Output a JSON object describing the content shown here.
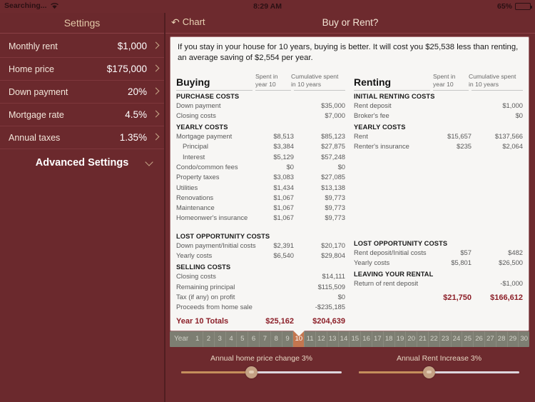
{
  "statusbar": {
    "carrier": "Searching...",
    "wifi_icon": "wifi-icon",
    "time": "8:29 AM",
    "battery_percent": "65%",
    "battery_icon": "battery-icon"
  },
  "sidebar": {
    "header": "Settings",
    "items": [
      {
        "label": "Monthly rent",
        "value": "$1,000"
      },
      {
        "label": "Home price",
        "value": "$175,000"
      },
      {
        "label": "Down payment",
        "value": "20%"
      },
      {
        "label": "Mortgage rate",
        "value": "4.5%"
      },
      {
        "label": "Annual taxes",
        "value": "1.35%"
      }
    ],
    "advanced_label": "Advanced Settings",
    "advanced_icon": "chevron-down-icon",
    "row_icon": "chevron-right-icon"
  },
  "navbar": {
    "back_label": "Chart",
    "back_icon": "back-arrow-icon",
    "title": "Buy or Rent?"
  },
  "summary": {
    "text": "If you stay in your house for  10 years, buying is better. It will cost you  $25,538 less than renting, an average saving of $2,554 per year."
  },
  "table": {
    "col_header_spent": "Spent in\nyear 10",
    "col_header_spent_l1": "Spent in",
    "col_header_spent_l2": "year 10",
    "col_header_cum_l1": "Cumulative spent",
    "col_header_cum_l2": "in 10 years",
    "buying": {
      "title": "Buying",
      "sections": [
        {
          "name": "PURCHASE COSTS",
          "rows": [
            {
              "label": "Down payment",
              "spent": "",
              "cumulative": "$35,000",
              "indent": false
            },
            {
              "label": "Closing costs",
              "spent": "",
              "cumulative": "$7,000",
              "indent": false
            }
          ]
        },
        {
          "name": "YEARLY COSTS",
          "rows": [
            {
              "label": "Mortgage payment",
              "spent": "$8,513",
              "cumulative": "$85,123",
              "indent": false
            },
            {
              "label": "Principal",
              "spent": "$3,384",
              "cumulative": "$27,875",
              "indent": true
            },
            {
              "label": "Interest",
              "spent": "$5,129",
              "cumulative": "$57,248",
              "indent": true
            },
            {
              "label": "Condo/common fees",
              "spent": "$0",
              "cumulative": "$0",
              "indent": false
            },
            {
              "label": "Property taxes",
              "spent": "$3,083",
              "cumulative": "$27,085",
              "indent": false
            },
            {
              "label": "Utilities",
              "spent": "$1,434",
              "cumulative": "$13,138",
              "indent": false
            },
            {
              "label": "Renovations",
              "spent": "$1,067",
              "cumulative": "$9,773",
              "indent": false
            },
            {
              "label": "Maintenance",
              "spent": "$1,067",
              "cumulative": "$9,773",
              "indent": false
            },
            {
              "label": "Homeonwer's insurance",
              "spent": "$1,067",
              "cumulative": "$9,773",
              "indent": false
            }
          ]
        },
        {
          "name": "LOST OPPORTUNITY COSTS",
          "gap_before": true,
          "rows": [
            {
              "label": "Down payment/Initial costs",
              "spent": "$2,391",
              "cumulative": "$20,170",
              "indent": false
            },
            {
              "label": "Yearly costs",
              "spent": "$6,540",
              "cumulative": "$29,804",
              "indent": false
            }
          ]
        },
        {
          "name": "SELLING COSTS",
          "rows": [
            {
              "label": "Closing costs",
              "spent": "",
              "cumulative": "$14,111",
              "indent": false
            },
            {
              "label": "Remaining principal",
              "spent": "",
              "cumulative": "$115,509",
              "indent": false
            },
            {
              "label": "Tax (if any) on profit",
              "spent": "",
              "cumulative": "$0",
              "indent": false
            },
            {
              "label": "Proceeds from home sale",
              "spent": "",
              "cumulative": "-$235,185",
              "indent": false
            }
          ]
        }
      ],
      "total_label": "Year 10 Totals",
      "total_spent": "$25,162",
      "total_cumulative": "$204,639"
    },
    "renting": {
      "title": "Renting",
      "sections": [
        {
          "name": "INITIAL RENTING COSTS",
          "rows": [
            {
              "label": "Rent deposit",
              "spent": "",
              "cumulative": "$1,000",
              "indent": false
            },
            {
              "label": "Broker's fee",
              "spent": "",
              "cumulative": "$0",
              "indent": false
            }
          ]
        },
        {
          "name": "YEARLY COSTS",
          "rows": [
            {
              "label": "Rent",
              "spent": "$15,657",
              "cumulative": "$137,566",
              "indent": false
            },
            {
              "label": "Renter's insurance",
              "spent": "$235",
              "cumulative": "$2,064",
              "indent": false
            }
          ]
        },
        {
          "name": "LOST OPPORTUNITY COSTS",
          "gap_before": true,
          "pad_top": 119,
          "rows": [
            {
              "label": "Rent deposit/Initial costs",
              "spent": "$57",
              "cumulative": "$482",
              "indent": false
            },
            {
              "label": "Yearly costs",
              "spent": "$5,801",
              "cumulative": "$26,500",
              "indent": false
            }
          ]
        },
        {
          "name": "LEAVING YOUR RENTAL",
          "rows": [
            {
              "label": "Return of rent deposit",
              "spent": "",
              "cumulative": "-$1,000",
              "indent": false
            }
          ]
        }
      ],
      "total_label": "",
      "total_spent": "$21,750",
      "total_cumulative": "$166,612"
    }
  },
  "yearstrip": {
    "label": "Year",
    "years": [
      "1",
      "2",
      "3",
      "4",
      "5",
      "6",
      "7",
      "8",
      "9",
      "10",
      "11",
      "12",
      "13",
      "14",
      "15",
      "16",
      "17",
      "18",
      "19",
      "20",
      "21",
      "22",
      "23",
      "24",
      "25",
      "26",
      "27",
      "28",
      "29",
      "30"
    ],
    "selected": "10",
    "selected_color": "#c4764f"
  },
  "sliders": [
    {
      "label": "Annual home price change 3%",
      "value_percent": 3,
      "fill_ratio": 0.435
    },
    {
      "label": "Annual Rent Increase 3%",
      "value_percent": 3,
      "fill_ratio": 0.435
    }
  ],
  "colors": {
    "app_background": "#6d2a2e",
    "card_background": "#f7f6f4",
    "total_red": "#8c1f28",
    "accent_tan": "#c9a98a",
    "year_strip": "#7d7e72"
  }
}
